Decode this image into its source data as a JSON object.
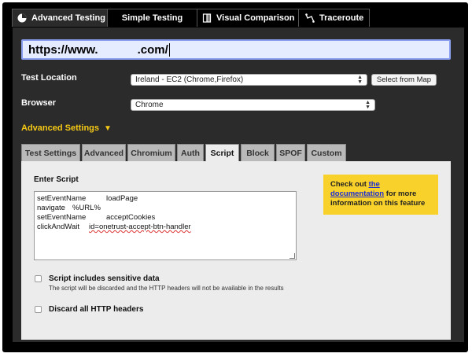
{
  "tabs": [
    {
      "label": "Advanced Testing",
      "icon": "gauge-icon",
      "active": true
    },
    {
      "label": "Simple Testing",
      "icon": "",
      "active": false
    },
    {
      "label": "Visual Comparison",
      "icon": "compare-icon",
      "active": false
    },
    {
      "label": "Traceroute",
      "icon": "traceroute-icon",
      "active": false
    }
  ],
  "url_input": {
    "value": "https://www.            .com/"
  },
  "test_location": {
    "label": "Test Location",
    "selected": "Ireland - EC2 (Chrome,Firefox)",
    "map_button": "Select from Map"
  },
  "browser": {
    "label": "Browser",
    "selected": "Chrome"
  },
  "advanced_settings": {
    "label": "Advanced Settings",
    "arrow": "▼"
  },
  "settings_tabs": [
    {
      "label": "Test Settings",
      "active": false
    },
    {
      "label": "Advanced",
      "active": false
    },
    {
      "label": "Chromium",
      "active": false
    },
    {
      "label": "Auth",
      "active": false
    },
    {
      "label": "Script",
      "active": true
    },
    {
      "label": "Block",
      "active": false
    },
    {
      "label": "SPOF",
      "active": false
    },
    {
      "label": "Custom",
      "active": false
    }
  ],
  "script": {
    "heading": "Enter Script",
    "lines": [
      {
        "cmd": "setEventName",
        "arg": "loadPage"
      },
      {
        "cmd": "navigate",
        "arg": "%URL%"
      },
      {
        "cmd": "setEventName",
        "arg": "acceptCookies"
      },
      {
        "cmd": "clickAndWait",
        "arg": "id=onetrust-accept-btn-handler"
      }
    ]
  },
  "help": {
    "prefix": "Check out ",
    "link_1": "the",
    "link_2": "documentation",
    "suffix": " for more information on this feature"
  },
  "sensitive": {
    "label": "Script includes sensitive data",
    "note": "The script will be discarded and the HTTP headers will not be available in the results",
    "checked": false
  },
  "discard_headers": {
    "label": "Discard all HTTP headers",
    "checked": false
  },
  "colors": {
    "accent": "#f6c915",
    "panel": "#2b2b2b",
    "url_bg": "#e6ecff",
    "help_bg": "#f8d12b"
  }
}
